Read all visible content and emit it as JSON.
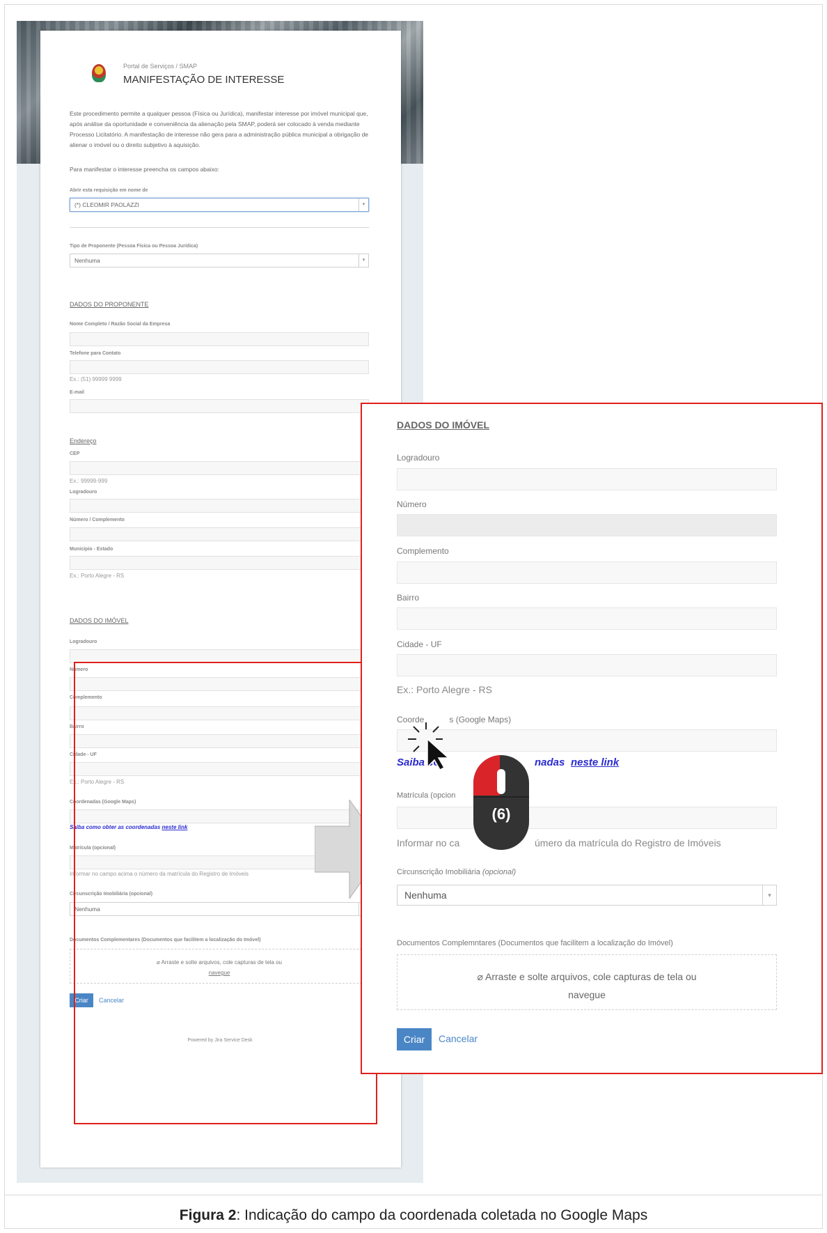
{
  "form": {
    "breadcrumb": "Portal de Serviços / SMAP",
    "title": "MANIFESTAÇÃO DE INTERESSE",
    "description": "Este procedimento permite a qualquer pessoa (Física ou Jurídica), manifestar interesse por imóvel municipal que, após análise da oportunidade e conveniência da alienação pela SMAP, poderá ser colocado à venda mediante Processo Licitatório. A manifestação de interesse não gera para a administração pública municipal a obrigação de alienar o imóvel ou o direito subjetivo à aquisição.",
    "instruction": "Para manifestar o interesse preencha os campos abaixo:",
    "request_on_behalf_label": "Abrir esta requisição em nome de",
    "request_on_behalf_value": "(*) CLEOMIR PAOLAZZI",
    "proponent_type_label": "Tipo de Proponente (Pessoa Física ou Pessoa Jurídica)",
    "proponent_type_value": "Nenhuma",
    "section_proponent": "DADOS DO PROPONENTE",
    "full_name_label": "Nome Completo / Razão Social da Empresa",
    "phone_label": "Telefone para Contato",
    "phone_hint": "Ex.: (51) 99999 9999",
    "email_label": "E-mail",
    "section_address": "Endereço",
    "cep_label": "CEP",
    "cep_hint": "Ex.: 99999-999",
    "street_label": "Logradouro",
    "number_complement_label": "Número / Complemento",
    "city_state_label": "Município - Estado",
    "city_state_hint": "Ex.: Porto Alegre - RS",
    "section_property": "DADOS DO IMÓVEL",
    "p_street_label": "Logradouro",
    "p_number_label": "Número",
    "p_complement_label": "Complemento",
    "p_district_label": "Bairro",
    "p_city_label": "Cidade - UF",
    "p_city_hint": "Ex.: Porto Alegre - RS",
    "p_coords_label": "Coordenadas (Google Maps)",
    "p_coords_link_text": "Saiba como obter as coordenadas",
    "p_coords_link_anchor": "neste link",
    "p_registration_label": "Matrícula (opcional)",
    "p_registration_hint": "Informar no campo acima o número da matrícula do Registro de Imóveis",
    "p_circumscription_label": "Circunscrição Imobiliária (opcional)",
    "p_circumscription_value": "Nenhuma",
    "p_docs_label": "Documentos Complementares (Documentos que facilitem a localização do Imóvel)",
    "p_drop_text_1": "Arraste e solte arquivos, cole capturas de tela ou",
    "p_drop_text_2": "navegue",
    "create_button": "Criar",
    "cancel_link": "Cancelar",
    "powered_by": "Powered by Jira Service Desk"
  },
  "zoom": {
    "section_property": "DADOS DO IMÓVEL",
    "street_label": "Logradouro",
    "number_label": "Número",
    "complement_label": "Complemento",
    "district_label": "Bairro",
    "city_label": "Cidade - UF",
    "city_hint": "Ex.: Porto Alegre - RS",
    "coords_label_a": "Coorde",
    "coords_label_b": "s (Google Maps)",
    "link_part_a": "Saiba co",
    "link_part_b": "nadas",
    "link_anchor": "neste link",
    "registration_label": "Matrícula (opcion",
    "registration_hint_a": "Informar no ca",
    "registration_hint_b": "úmero da matrícula do Registro de Imóveis",
    "circumscription_label": "Circunscrição Imobiliária",
    "circumscription_opt": "(opcional)",
    "circumscription_value": "Nenhuma",
    "docs_label": "Documentos Complemntares (Documentos que facilitem a localização do Imóvel)",
    "drop_text_1": "Arraste e solte arquivos, cole capturas de tela ou",
    "drop_text_2": "navegue",
    "create_button": "Criar",
    "cancel_link": "Cancelar"
  },
  "annotation": {
    "step_label": "(6)",
    "colors": {
      "highlight": "#e0201b",
      "mouse_button": "#d9252a",
      "mouse_body": "#333333",
      "link": "#2b2bd1"
    }
  },
  "caption": {
    "bold": "Figura 2",
    "text": ": Indicação do campo da coordenada coletada no Google Maps"
  }
}
